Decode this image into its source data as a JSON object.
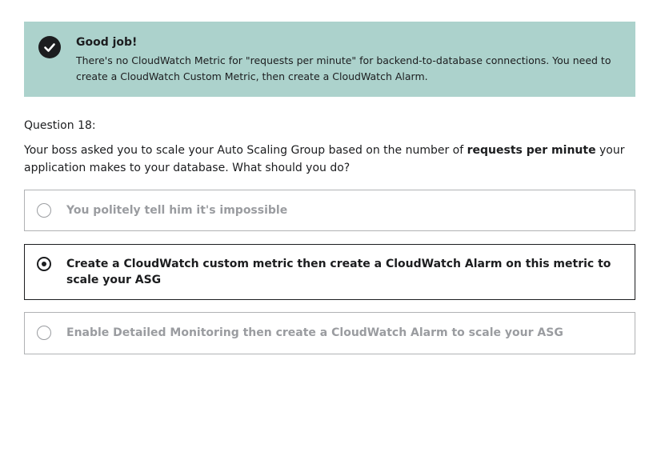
{
  "feedback": {
    "title": "Good job!",
    "text": "There's no CloudWatch Metric for \"requests per minute\" for backend-to-database connections. You need to create a CloudWatch Custom Metric, then create a CloudWatch Alarm.",
    "icon": "check-circle-icon",
    "background_color": "#acd2cc"
  },
  "question": {
    "label": "Question 18:",
    "text_before": "Your boss asked you to scale your Auto Scaling Group based on the number of ",
    "text_bold": "requests per minute",
    "text_after": " your application makes to your database. What should you do?"
  },
  "options": [
    {
      "label": "You politely tell him it's impossible",
      "selected": false
    },
    {
      "label": "Create a CloudWatch custom metric then create a CloudWatch Alarm on this metric to scale your ASG",
      "selected": true
    },
    {
      "label": "Enable Detailed Monitoring then create a CloudWatch Alarm to scale your ASG",
      "selected": false
    }
  ]
}
